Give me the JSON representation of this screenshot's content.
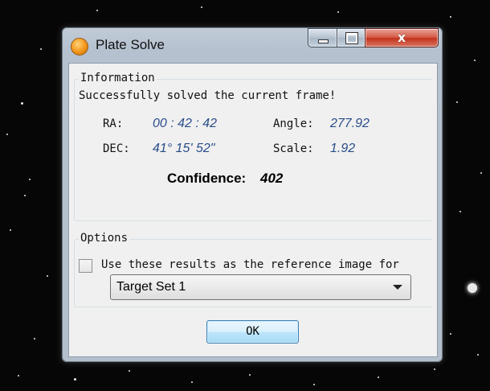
{
  "window": {
    "title": "Plate Solve"
  },
  "information": {
    "group_label": "Information",
    "status": "Successfully solved the current frame!",
    "ra_label": "RA:",
    "ra_value": "00 : 42 : 42",
    "dec_label": "DEC:",
    "dec_value": "41° 15' 52\"",
    "angle_label": "Angle:",
    "angle_value": "277.92",
    "scale_label": "Scale:",
    "scale_value": "1.92",
    "confidence_label": "Confidence:",
    "confidence_value": "402"
  },
  "options": {
    "group_label": "Options",
    "checkbox_label": "Use these results as the reference image for",
    "checkbox_checked": false,
    "target_set_selected": "Target Set 1"
  },
  "buttons": {
    "ok_label": "OK",
    "close_glyph": "x"
  }
}
